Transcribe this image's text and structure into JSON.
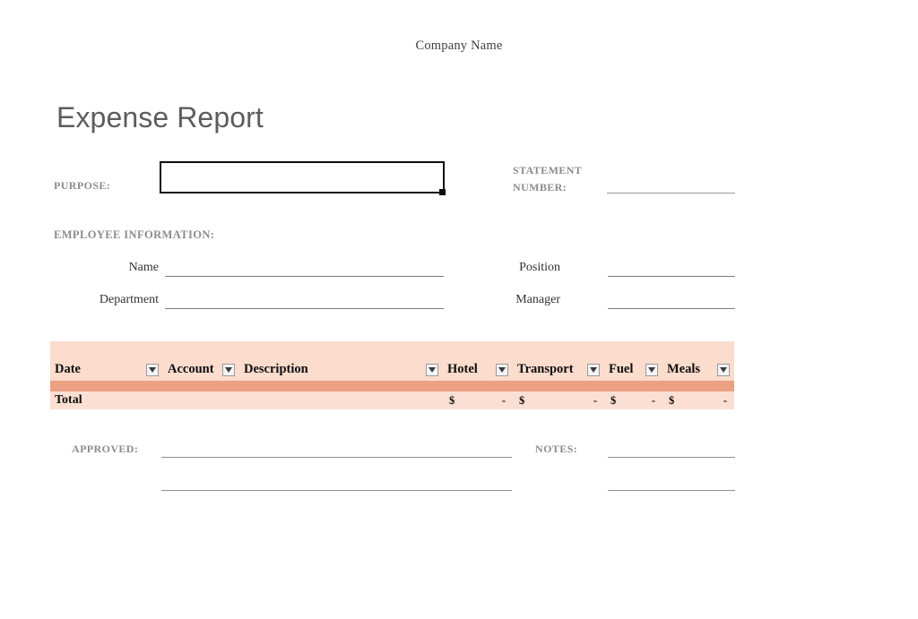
{
  "document": {
    "company_name": "Company Name",
    "title": "Expense Report"
  },
  "purpose": {
    "label": "PURPOSE:",
    "value": "",
    "placeholder": ""
  },
  "statement": {
    "label_line1": "STATEMENT",
    "label_line2": "NUMBER:",
    "value": ""
  },
  "employee": {
    "section_label": "EMPLOYEE INFORMATION:",
    "fields": [
      {
        "label": "Name",
        "value": ""
      },
      {
        "label": "Department",
        "value": ""
      },
      {
        "label": "Position",
        "value": ""
      },
      {
        "label": "Manager",
        "value": ""
      }
    ]
  },
  "table": {
    "columns": [
      {
        "label": "Date",
        "filter": true
      },
      {
        "label": "Account",
        "filter": true
      },
      {
        "label": "Description",
        "filter": true
      },
      {
        "label": "Hotel",
        "filter": true
      },
      {
        "label": "Transport",
        "filter": true
      },
      {
        "label": "Fuel",
        "filter": true
      },
      {
        "label": "Meals",
        "filter": true
      }
    ],
    "total_row": {
      "label": "Total",
      "cells": [
        {
          "currency": "",
          "amount": ""
        },
        {
          "currency": "",
          "amount": ""
        },
        {
          "currency": "$",
          "amount": "-"
        },
        {
          "currency": "$",
          "amount": "-"
        },
        {
          "currency": "$",
          "amount": "-"
        },
        {
          "currency": "$",
          "amount": "-"
        }
      ]
    },
    "filter_icon": "chevron-down-icon"
  },
  "footer": {
    "approved_label": "APPROVED:",
    "notes_label": "NOTES:",
    "approved_value_1": "",
    "approved_value_2": "",
    "notes_value_1": "",
    "notes_value_2": ""
  },
  "colors": {
    "header_bg": "#fbdccd",
    "band_bg": "#eda183",
    "band_border": "#ce5526",
    "total_bg": "#fbdfd3",
    "title_text": "#5d5d5d",
    "label_text": "#8c8c8c"
  }
}
